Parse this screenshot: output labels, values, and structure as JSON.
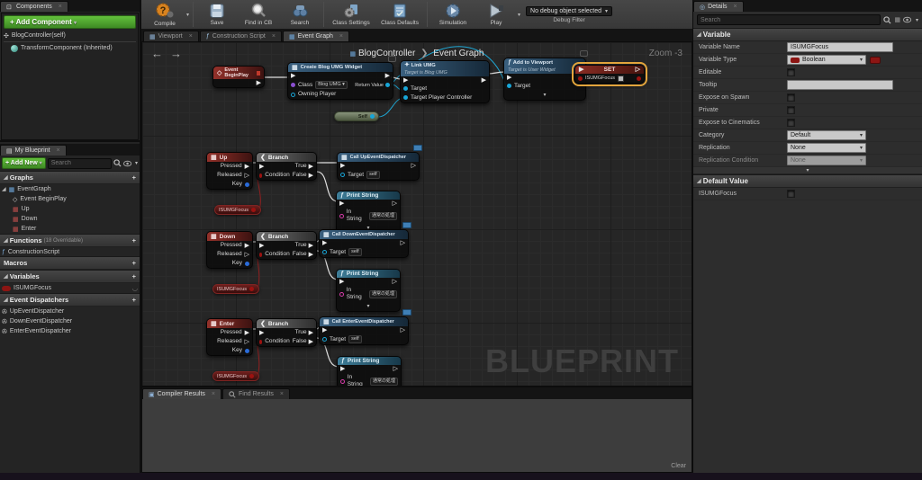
{
  "components_panel": {
    "tab": "Components",
    "add_button": "+ Add Component",
    "self_item": "BlogController(self)",
    "inherited_item": "TransformComponent (Inherited)"
  },
  "my_blueprint": {
    "tab": "My Blueprint",
    "add_new": "+ Add New",
    "search_placeholder": "Search",
    "graphs_title": "Graphs",
    "graphs": [
      "EventGraph",
      "Event BeginPlay",
      "Up",
      "Down",
      "Enter"
    ],
    "functions_title": "Functions",
    "functions_hint": "(18 Overridable)",
    "functions": [
      "ConstructionScript"
    ],
    "macros_title": "Macros",
    "variables_title": "Variables",
    "variables": [
      "ISUMGFocus"
    ],
    "dispatchers_title": "Event Dispatchers",
    "dispatchers": [
      "UpEventDispatcher",
      "DownEventDispatcher",
      "EnterEventDispatcher"
    ]
  },
  "toolbar": {
    "compile": "Compile",
    "save": "Save",
    "find": "Find in CB",
    "search": "Search",
    "class_settings": "Class Settings",
    "class_defaults": "Class Defaults",
    "simulation": "Simulation",
    "play": "Play",
    "debug_select": "No debug object selected",
    "debug_filter": "Debug Filter"
  },
  "doc_tabs": {
    "viewport": "Viewport",
    "construction": "Construction Script",
    "event_graph": "Event Graph"
  },
  "graph": {
    "breadcrumb_root": "BlogController",
    "breadcrumb_current": "Event Graph",
    "zoom_label": "Zoom -3",
    "watermark": "BLUEPRINT",
    "nodes": {
      "begin_play": "Event BeginPlay",
      "create_widget": {
        "title": "Create Blog UMG Widget",
        "class_label": "Class",
        "class_value": "Blog UMG",
        "owning_player": "Owning Player",
        "return_value": "Return Value"
      },
      "self_node": "Self",
      "link_umg": {
        "title": "Link UMG",
        "subtitle": "Target is Blog UMG",
        "target": "Target",
        "target_pc": "Target Player Controller"
      },
      "add_viewport": {
        "title": "Add to Viewport",
        "subtitle": "Target is User Widget",
        "target": "Target"
      },
      "set_node": {
        "title": "SET",
        "var_name": "ISUMGFocus"
      },
      "branch": {
        "title": "Branch",
        "condition": "Condition",
        "true_label": "True",
        "false_label": "False"
      },
      "event_pins": {
        "pressed": "Pressed",
        "released": "Released",
        "key": "Key"
      },
      "up_event": "Up",
      "down_event": "Down",
      "enter_event": "Enter",
      "call_up": "Call UpEventDispatcher",
      "call_down": "Call DownEventDispatcher",
      "call_enter": "Call EnterEventDispatcher",
      "print_string": {
        "title": "Print String",
        "in_string": "In String",
        "value": "通常の処理"
      },
      "getter": "ISUMGFocus",
      "target_label": "Target",
      "self_literal": "self"
    }
  },
  "bottom_panel": {
    "compiler_tab": "Compiler Results",
    "find_tab": "Find Results",
    "clear": "Clear"
  },
  "details": {
    "tab": "Details",
    "search_placeholder": "Search",
    "variable_title": "Variable",
    "rows": {
      "name_label": "Variable Name",
      "name_value": "ISUMGFocus",
      "type_label": "Variable Type",
      "type_value": "Boolean",
      "editable": "Editable",
      "tooltip": "Tooltip",
      "expose_spawn": "Expose on Spawn",
      "private": "Private",
      "expose_cine": "Expose to Cinematics",
      "category_label": "Category",
      "category_value": "Default",
      "replication_label": "Replication",
      "replication_value": "None",
      "repcond_label": "Replication Condition",
      "repcond_value": "None"
    },
    "default_title": "Default Value",
    "default_var": "ISUMGFocus"
  }
}
